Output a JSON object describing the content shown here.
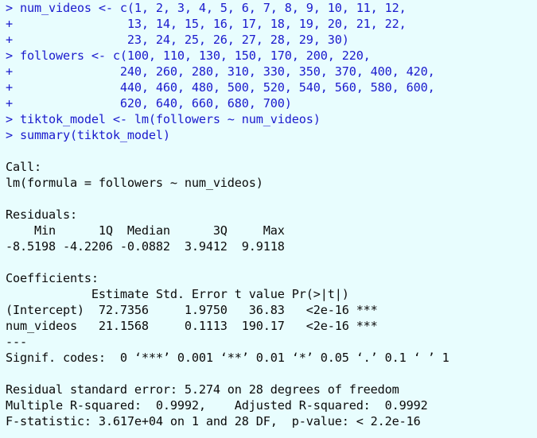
{
  "colors": {
    "background": "#e8fdfe",
    "input_text": "#1a1acd",
    "output_text": "#0a0a0a"
  },
  "console": {
    "input_lines": [
      "> num_videos <- c(1, 2, 3, 4, 5, 6, 7, 8, 9, 10, 11, 12,",
      "+                13, 14, 15, 16, 17, 18, 19, 20, 21, 22,",
      "+                23, 24, 25, 26, 27, 28, 29, 30)",
      "> followers <- c(100, 110, 130, 150, 170, 200, 220,",
      "+               240, 260, 280, 310, 330, 350, 370, 400, 420,",
      "+               440, 460, 480, 500, 520, 540, 560, 580, 600,",
      "+               620, 640, 660, 680, 700)",
      "> tiktok_model <- lm(followers ~ num_videos)",
      "> summary(tiktok_model)"
    ],
    "output": {
      "call_header": "Call:",
      "call_formula": "lm(formula = followers ~ num_videos)",
      "residuals_header": "Residuals:",
      "residuals_labels": "    Min      1Q  Median      3Q     Max ",
      "residuals_values": "-8.5198 -4.2206 -0.0882  3.9412  9.9118 ",
      "coefficients_header": "Coefficients:",
      "coefficients_columns": "            Estimate Std. Error t value Pr(>|t|)    ",
      "coefficients_rows": [
        "(Intercept)  72.7356     1.9750   36.83   <2e-16 ***",
        "num_videos   21.1568     0.1113  190.17   <2e-16 ***"
      ],
      "separator": "---",
      "signif_codes": "Signif. codes:  0 ‘***’ 0.001 ‘**’ 0.01 ‘*’ 0.05 ‘.’ 0.1 ‘ ’ 1",
      "residual_se": "Residual standard error: 5.274 on 28 degrees of freedom",
      "r_squared": "Multiple R-squared:  0.9992,\tAdjusted R-squared:  0.9992 ",
      "f_statistic": "F-statistic: 3.617e+04 on 1 and 28 DF,  p-value: < 2.2e-16"
    }
  }
}
